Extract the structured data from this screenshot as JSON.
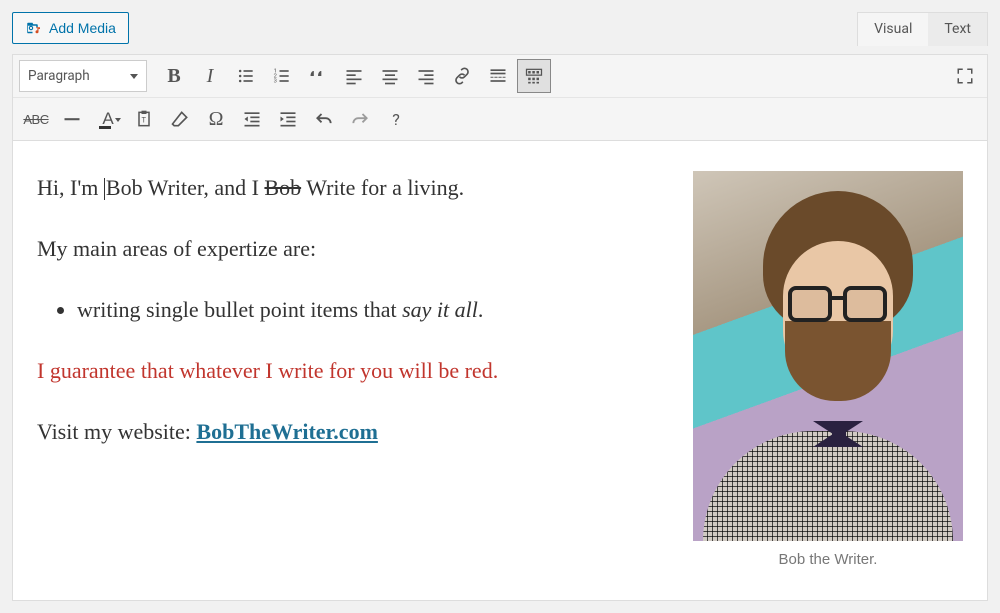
{
  "buttons": {
    "add_media": "Add Media"
  },
  "tabs": {
    "visual": "Visual",
    "text": "Text",
    "active": "visual"
  },
  "format_dropdown": {
    "selected": "Paragraph"
  },
  "toolbar_row1": [
    {
      "name": "bold",
      "glyph": "B"
    },
    {
      "name": "italic",
      "glyph": "I"
    },
    {
      "name": "bulleted-list"
    },
    {
      "name": "numbered-list"
    },
    {
      "name": "blockquote"
    },
    {
      "name": "align-left"
    },
    {
      "name": "align-center"
    },
    {
      "name": "align-right"
    },
    {
      "name": "insert-link"
    },
    {
      "name": "insert-more"
    },
    {
      "name": "toolbar-toggle",
      "active": true
    }
  ],
  "toolbar_row2": [
    {
      "name": "strikethrough",
      "glyph": "ABC"
    },
    {
      "name": "horizontal-rule"
    },
    {
      "name": "text-color",
      "glyph": "A"
    },
    {
      "name": "paste-as-text"
    },
    {
      "name": "clear-formatting"
    },
    {
      "name": "special-character",
      "glyph": "Ω"
    },
    {
      "name": "decrease-indent"
    },
    {
      "name": "increase-indent"
    },
    {
      "name": "undo"
    },
    {
      "name": "redo"
    },
    {
      "name": "keyboard-shortcuts",
      "glyph": "?"
    }
  ],
  "content": {
    "p1_a": "Hi, I'm ",
    "p1_b": "Bob Writer, and I ",
    "p1_strike": "Bob",
    "p1_c": " Write for a living.",
    "p2": "My main areas of expertize are:",
    "bullet_a": "writing single bullet point items that ",
    "bullet_ital": "say it all",
    "bullet_b": ".",
    "p3": "I guarantee that whatever I write for you will be red.",
    "p4_a": "Visit my website: ",
    "p4_link": "BobTheWriter.com"
  },
  "image": {
    "caption": "Bob the Writer.",
    "alt": "Portrait of a man with glasses, beard, bow tie, checkered shirt"
  }
}
